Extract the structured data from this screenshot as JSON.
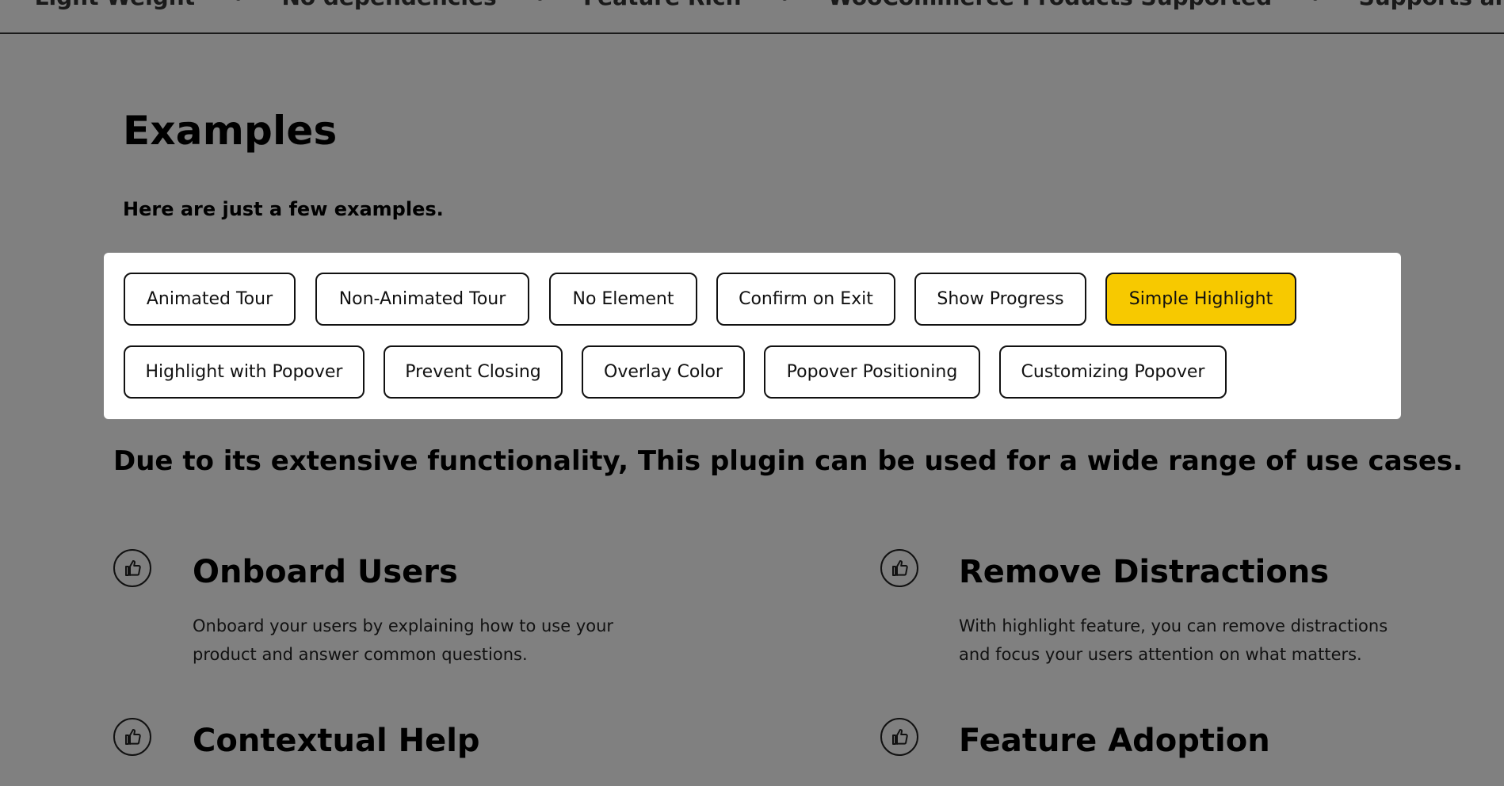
{
  "ticker": {
    "items": [
      "Light Weight",
      "No dependencies",
      "Feature Rich",
      "WooCommerce Products Supported",
      "Supports all major Browsers"
    ]
  },
  "examples": {
    "title": "Examples",
    "subtitle": "Here are just a few examples.",
    "buttons": [
      "Animated Tour",
      "Non-Animated Tour",
      "No Element",
      "Confirm on Exit",
      "Show Progress",
      "Simple Highlight",
      "Highlight with Popover",
      "Prevent Closing",
      "Overlay Color",
      "Popover Positioning",
      "Customizing Popover"
    ],
    "active_button": "Simple Highlight"
  },
  "use_cases": {
    "heading": "Due to its extensive functionality, This plugin can be used for a wide range of use cases.",
    "features": [
      {
        "icon": "thumbs-up-icon",
        "title": "Onboard Users",
        "description": "Onboard your users by explaining how to use your product and answer common questions."
      },
      {
        "icon": "thumbs-up-icon",
        "title": "Remove Distractions",
        "description": "With highlight feature, you can remove distractions and focus your users attention on what matters."
      },
      {
        "icon": "thumbs-up-icon",
        "title": "Contextual Help",
        "description": ""
      },
      {
        "icon": "thumbs-up-icon",
        "title": "Feature Adoption",
        "description": ""
      }
    ]
  },
  "colors": {
    "overlay_background": "#808080",
    "panel_background": "#ffffff",
    "active_button": "#f7c900",
    "text": "#000000"
  }
}
